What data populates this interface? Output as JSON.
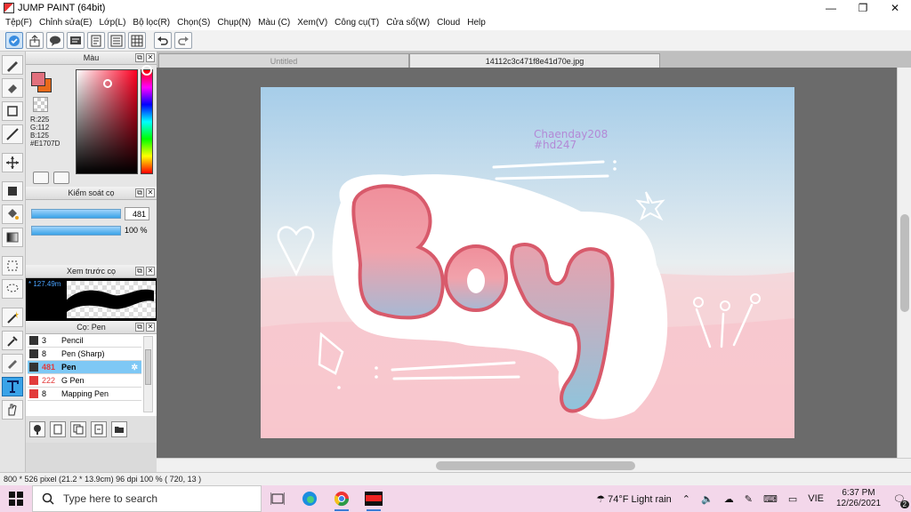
{
  "window": {
    "title": "JUMP PAINT (64bit)",
    "controls": [
      "—",
      "❐",
      "✕"
    ]
  },
  "menu": [
    "Tệp(F)",
    "Chỉnh sửa(E)",
    "Lớp(L)",
    "Bộ lọc(R)",
    "Chọn(S)",
    "Chụp(N)",
    "Màu (C)",
    "Xem(V)",
    "Công cụ(T)",
    "Cửa sổ(W)",
    "Cloud",
    "Help"
  ],
  "panels": {
    "color": {
      "title": "Màu",
      "front_color": "#E1707D",
      "back_color": "#e86a1a",
      "r": "R:225",
      "g": "G:112",
      "b": "B:125",
      "hex": "#E1707D"
    },
    "brush_control": {
      "title": "Kiểm soát cọ",
      "size_value": "481",
      "opacity_value": "100 %"
    },
    "preview": {
      "title": "Xem trước cọ",
      "size_text": "* 127.49m"
    },
    "brush_list": {
      "title": "Cọ: Pen",
      "items": [
        {
          "size": "3",
          "name": "Pencil",
          "color": "#333333",
          "selected": false
        },
        {
          "size": "8",
          "name": "Pen (Sharp)",
          "color": "#333333",
          "selected": false
        },
        {
          "size": "481",
          "name": "Pen",
          "color": "#333333",
          "selected": true
        },
        {
          "size": "222",
          "name": "G Pen",
          "color": "#e23b3b",
          "selected": false
        },
        {
          "size": "8",
          "name": "Mapping Pen",
          "color": "#e23b3b",
          "selected": false
        }
      ]
    }
  },
  "tabs": [
    {
      "label": "Untitled",
      "active": false
    },
    {
      "label": "14112c3c471f8e41d70e.jpg",
      "active": true
    }
  ],
  "artwork": {
    "credit_name": "Chaenday208",
    "credit_tag": "#hd247",
    "word": "Boy"
  },
  "status": {
    "text": "800 * 526 pixel  (21.2 * 13.9cm)  96 dpi  100 %  ( 720, 13 )"
  },
  "taskbar": {
    "search_placeholder": "Type here to search",
    "weather": "74°F  Light rain",
    "lang": "VIE",
    "time": "6:37 PM",
    "date": "12/26/2021",
    "notification_count": "2"
  }
}
